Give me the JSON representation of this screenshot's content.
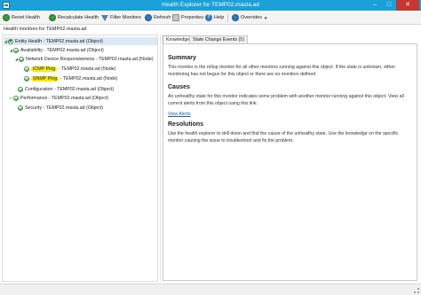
{
  "window": {
    "title": "Health Explorer for TEMP02.masta.ad",
    "minimize_glyph": "–",
    "maximize_glyph": "□",
    "close_glyph": "✕"
  },
  "toolbar": {
    "reset_health": "Reset Health",
    "recalculate_health": "Recalculate Health",
    "filter_monitors": "Filter Monitors",
    "refresh": "Refresh",
    "properties": "Properties",
    "help": "Help",
    "overrides": "Overrides",
    "overrides_caret": "▼",
    "help_glyph": "?"
  },
  "left_pane": {
    "header": "Health monitors for TEMP02.masta.ad"
  },
  "tree": {
    "expand_glyph": "◢",
    "collapsed_glyph": "▷",
    "nodes": [
      {
        "label": "Entity Health - TEMP02.masta.ad (Object)"
      },
      {
        "label": "Availability - TEMP02.masta.ad (Object)"
      },
      {
        "label": "Network Device Responsiveness - TEMP02.masta.ad (Node)"
      },
      {
        "label": "ICMP Ping - TEMP02.masta.ad (Node)",
        "highlight": "ICMP Ping"
      },
      {
        "label": "SNMP Ping - TEMP02.masta.ad (Node)",
        "highlight": "SNMP Ping"
      },
      {
        "label": "Configuration - TEMP02.masta.ad (Object)"
      },
      {
        "label": "Performance - TEMP02.masta.ad (Object)"
      },
      {
        "label": "Security - TEMP02.masta.ad (Object)"
      }
    ]
  },
  "tabs": [
    {
      "label": "Knowledge",
      "active": true
    },
    {
      "label": "State Change Events (5)",
      "active": false
    }
  ],
  "knowledge": {
    "summary_heading": "Summary",
    "summary_text": "This monitor is the rollup monitor for all other monitors running against this object. If the state is unknown, either monitoring has not begun for this object or there are no monitors defined.",
    "causes_heading": "Causes",
    "causes_text": "An unhealthy state for this monitor indicates some problem with another monitor running against this object. View all current alerts from this object using this link:",
    "view_alerts_link": "View Alerts",
    "resolutions_heading": "Resolutions",
    "resolutions_text": "Use the health explorer to drill down and find the cause of the unhealthy state. Use the knowledge on the specific monitor causing the issue to troubleshoot and fix the problem."
  },
  "colors": {
    "titlebar": "#1ca0d8",
    "healthy_green": "#3d9a3d",
    "highlight_yellow": "#f5ec00",
    "link_blue": "#1a5fb4"
  }
}
